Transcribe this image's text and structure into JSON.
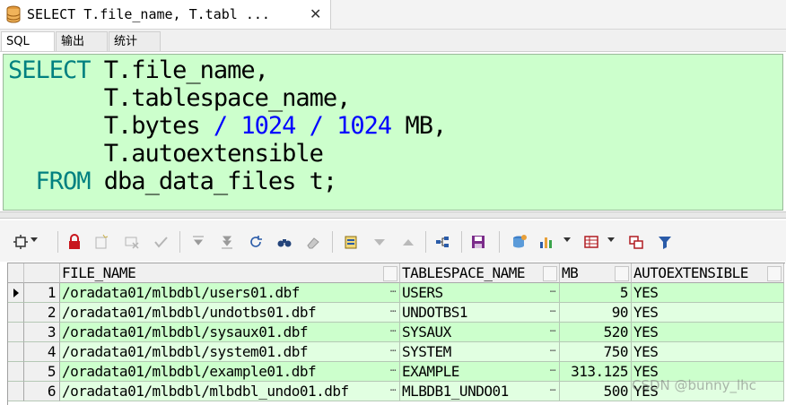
{
  "window": {
    "tab_title": "SELECT T.file_name, T.tabl ...",
    "close_glyph": "✕"
  },
  "sub_tabs": [
    {
      "label": "SQL",
      "active": true
    },
    {
      "label": "输出",
      "active": false
    },
    {
      "label": "统计",
      "active": false
    }
  ],
  "editor": {
    "lines": [
      [
        {
          "t": "SELECT ",
          "c": "kw"
        },
        {
          "t": "T.file_name,",
          "c": ""
        }
      ],
      [
        {
          "t": "       T.tablespace_name,",
          "c": ""
        }
      ],
      [
        {
          "t": "       T.bytes ",
          "c": ""
        },
        {
          "t": "/ ",
          "c": "op"
        },
        {
          "t": "1024 ",
          "c": "num"
        },
        {
          "t": "/ ",
          "c": "op"
        },
        {
          "t": "1024",
          "c": "num"
        },
        {
          "t": " MB,",
          "c": ""
        }
      ],
      [
        {
          "t": "       T.autoextensible",
          "c": ""
        }
      ],
      [
        {
          "t": "  FROM ",
          "c": "kw"
        },
        {
          "t": "dba_data_files t;",
          "c": ""
        }
      ]
    ]
  },
  "toolbar": {
    "icons": [
      "grid-options-icon",
      "lock-icon",
      "new-record-icon",
      "delete-record-icon",
      "post-icon",
      "sort-desc-icon",
      "sort-last-icon",
      "refresh-icon",
      "find-icon",
      "clear-icon",
      "export-icon",
      "move-down-icon",
      "move-up-icon",
      "link-icon",
      "save-icon",
      "query-by-example-icon",
      "chart-icon",
      "table-view-icon",
      "compare-icon",
      "filter-icon"
    ]
  },
  "grid": {
    "columns": [
      "FILE_NAME",
      "TABLESPACE_NAME",
      "MB",
      "AUTOEXTENSIBLE"
    ],
    "rows": [
      {
        "num": "1",
        "file_name": "/oradata01/mlbdbl/users01.dbf",
        "tablespace": "USERS",
        "mb": "5",
        "auto": "YES"
      },
      {
        "num": "2",
        "file_name": "/oradata01/mlbdbl/undotbs01.dbf",
        "tablespace": "UNDOTBS1",
        "mb": "90",
        "auto": "YES"
      },
      {
        "num": "3",
        "file_name": "/oradata01/mlbdbl/sysaux01.dbf",
        "tablespace": "SYSAUX",
        "mb": "520",
        "auto": "YES"
      },
      {
        "num": "4",
        "file_name": "/oradata01/mlbdbl/system01.dbf",
        "tablespace": "SYSTEM",
        "mb": "750",
        "auto": "YES"
      },
      {
        "num": "5",
        "file_name": "/oradata01/mlbdbl/example01.dbf",
        "tablespace": "EXAMPLE",
        "mb": "313.125",
        "auto": "YES"
      },
      {
        "num": "6",
        "file_name": "/oradata01/mlbdbl/mlbdbl_undo01.dbf",
        "tablespace": "MLBDB1_UNDO01",
        "mb": "500",
        "auto": "YES"
      }
    ]
  },
  "watermark": "CSDN @bunny_lhc"
}
